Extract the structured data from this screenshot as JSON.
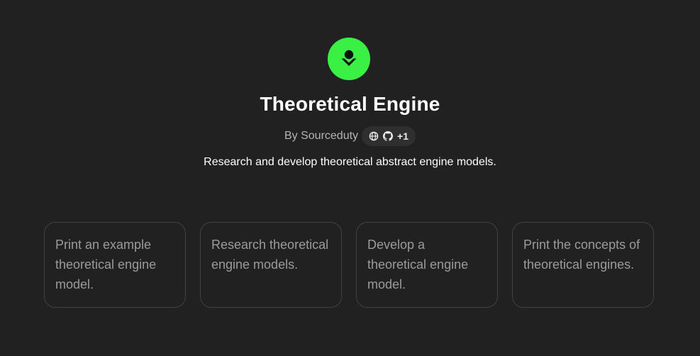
{
  "gpt": {
    "icon": "download-person-icon",
    "accent_color": "#3bf044",
    "title": "Theoretical Engine",
    "by_label": "By Sourceduty",
    "links": {
      "icons": [
        "globe-icon",
        "github-icon"
      ],
      "more_count": "+1"
    },
    "description": "Research and develop theoretical abstract engine models."
  },
  "conversation_starters": [
    {
      "label": "Print an example theoretical engine model."
    },
    {
      "label": "Research theoretical engine models."
    },
    {
      "label": "Develop a theoretical engine model."
    },
    {
      "label": "Print the concepts of theoretical engines."
    }
  ]
}
